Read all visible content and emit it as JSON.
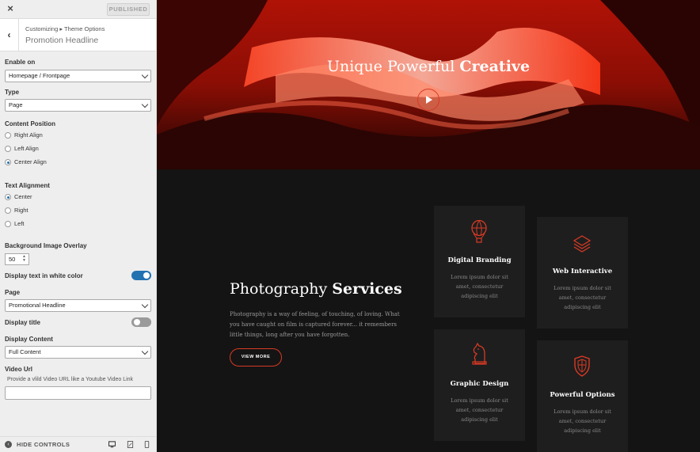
{
  "sidebar": {
    "close_icon": "×",
    "publish_label": "PUBLISHED",
    "breadcrumb": "Customizing ▸ Theme Options",
    "panel_title": "Promotion Headline",
    "enable_on": {
      "label": "Enable on",
      "value": "Homepage / Frontpage"
    },
    "type": {
      "label": "Type",
      "value": "Page"
    },
    "content_position": {
      "label": "Content Position",
      "options": [
        "Right Align",
        "Left Align",
        "Center Align"
      ],
      "selected": "Center Align"
    },
    "text_alignment": {
      "label": "Text Alignment",
      "options": [
        "Center",
        "Right",
        "Left"
      ],
      "selected": "Center"
    },
    "overlay": {
      "label": "Background Image Overlay",
      "value": "50"
    },
    "white_text": {
      "label": "Display text in white color",
      "on": true
    },
    "page": {
      "label": "Page",
      "value": "Promotional Headline"
    },
    "display_title": {
      "label": "Display title",
      "on": false
    },
    "display_content": {
      "label": "Display Content",
      "value": "Full Content"
    },
    "video_url": {
      "label": "Video Url",
      "description": "Provide a vlild Video URL like a Youtube Video Link",
      "value": ""
    },
    "hide_controls": "HIDE CONTROLS"
  },
  "colors": {
    "accent": "#d83a24",
    "toggle_on": "#2271b1",
    "toggle_off": "#9a9a9a"
  },
  "hero": {
    "title_regular": "Unique Powerful ",
    "title_bold": "Creative"
  },
  "services": {
    "title_regular": "Photography ",
    "title_bold": "Services",
    "description": "Photography is a way of feeling, of touching, of loving. What you have caught on film is captured forever... it remembers little things, long after you have forgotten.",
    "button": "VIEW MORE",
    "cards": [
      {
        "title": "Digital Branding",
        "text": "Lorem ipsum dolor sit amet, consectetur adipiscing elit",
        "icon": "hot-air-balloon-icon"
      },
      {
        "title": "Web Interactive",
        "text": "Lorem ipsum dolor sit amet, consectetur adipiscing elit",
        "icon": "layers-icon"
      },
      {
        "title": "Graphic Design",
        "text": "Lorem ipsum dolor sit amet, consectetur adipiscing elit",
        "icon": "chess-knight-icon"
      },
      {
        "title": "Powerful Options",
        "text": "Lorem ipsum dolor sit amet, consectetur adipiscing elit",
        "icon": "shield-icon"
      }
    ]
  }
}
